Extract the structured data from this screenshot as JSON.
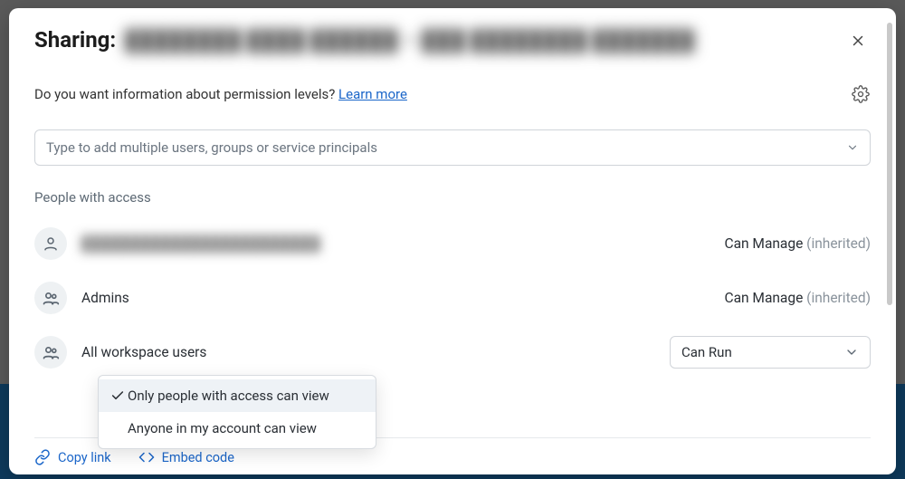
{
  "header": {
    "title": "Sharing:",
    "redacted_subject": "████████ ████ ██████ – ███ ████████ ███████"
  },
  "info": {
    "prompt": "Do you want information about permission levels? ",
    "learn_more": "Learn more"
  },
  "search": {
    "placeholder": "Type to add multiple users, groups or service principals"
  },
  "section_label": "People with access",
  "people": [
    {
      "name_redacted": true,
      "name": "████████████████████████",
      "icon": "person",
      "permission_label": "Can Manage",
      "inherited_label": "(inherited)",
      "permission_type": "static"
    },
    {
      "name_redacted": false,
      "name": "Admins",
      "icon": "group",
      "permission_label": "Can Manage",
      "inherited_label": "(inherited)",
      "permission_type": "static"
    },
    {
      "name_redacted": false,
      "name": "All workspace users",
      "icon": "group",
      "permission_label": "Can Run",
      "inherited_label": "",
      "permission_type": "select"
    }
  ],
  "visibility_menu": {
    "options": [
      {
        "label": "Only people with access can view",
        "selected": true
      },
      {
        "label": "Anyone in my account can view",
        "selected": false
      }
    ]
  },
  "footer": {
    "copy_link": "Copy link",
    "embed_code": "Embed code"
  }
}
